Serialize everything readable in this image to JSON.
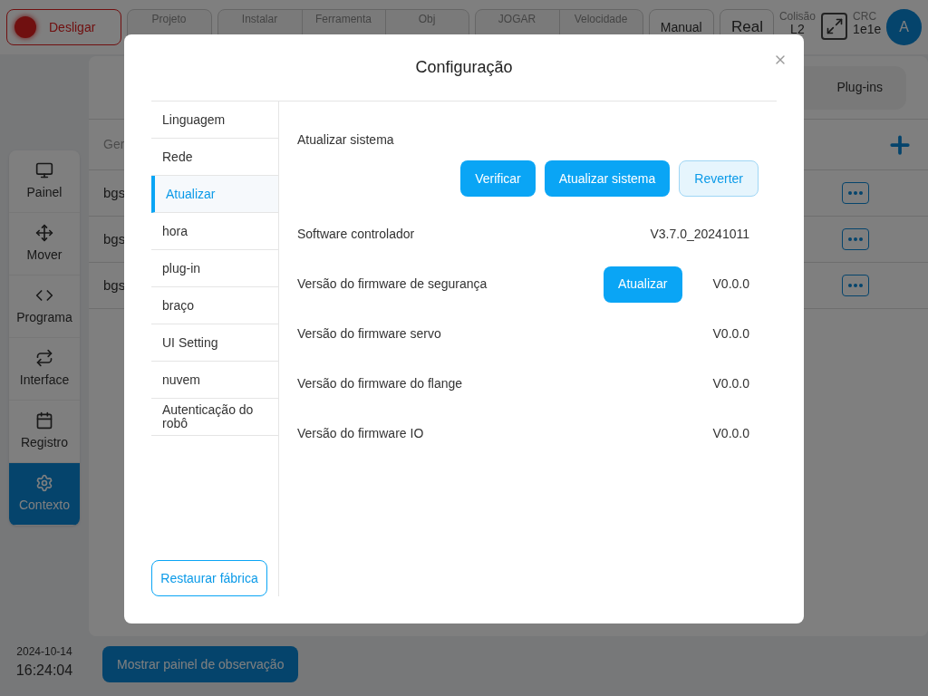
{
  "top_bar": {
    "power_button": "Desligar",
    "status_groups": [
      {
        "fields": [
          {
            "label": "Projeto"
          }
        ]
      },
      {
        "fields": [
          {
            "label": "Instalar"
          },
          {
            "label": "Ferramenta"
          },
          {
            "label": "Obj"
          }
        ]
      },
      {
        "fields": [
          {
            "label": "JOGAR"
          },
          {
            "label": "Velocidade"
          }
        ]
      }
    ],
    "mode_buttons": [
      "Manual",
      "Real"
    ],
    "collision": {
      "label": "Colisão",
      "value": "L2"
    },
    "crc": {
      "label": "CRC",
      "value": "1e1e"
    },
    "avatar": "A"
  },
  "nav": {
    "items": [
      {
        "label": "Painel",
        "selected": false
      },
      {
        "label": "Mover",
        "selected": false
      },
      {
        "label": "Programa",
        "selected": false
      },
      {
        "label": "Interface",
        "selected": false
      },
      {
        "label": "Registro",
        "selected": false
      },
      {
        "label": "Contexto",
        "selected": true
      }
    ]
  },
  "background_panel": {
    "tabs": [
      {
        "label": "Plug-ins"
      }
    ],
    "column_header": "Ger",
    "rows": [
      "bgs",
      "bgs",
      "bgs"
    ]
  },
  "clock": {
    "date": "2024-10-14",
    "time": "16:24:04"
  },
  "watch_button": "Mostrar painel de observação",
  "dialog": {
    "title": "Configuração",
    "menu": [
      {
        "label": "Linguagem",
        "selected": false
      },
      {
        "label": "Rede",
        "selected": false
      },
      {
        "label": "Atualizar",
        "selected": true
      },
      {
        "label": "hora",
        "selected": false
      },
      {
        "label": "plug-in",
        "selected": false
      },
      {
        "label": "braço",
        "selected": false
      },
      {
        "label": "UI Setting",
        "selected": false
      },
      {
        "label": "nuvem",
        "selected": false
      },
      {
        "label": "Autenticação do robô",
        "selected": false
      }
    ],
    "restore_button": "Restaurar fábrica",
    "section_title": "Atualizar sistema",
    "buttons": [
      {
        "label": "Verificar",
        "kind": "primary"
      },
      {
        "label": "Atualizar sistema",
        "kind": "primary"
      },
      {
        "label": "Reverter",
        "kind": "secondary"
      }
    ],
    "rows": [
      {
        "label": "Software controlador",
        "value": "V3.7.0_20241011"
      },
      {
        "label": "Versão do firmware de segurança",
        "value": "V0.0.0",
        "action": "Atualizar"
      },
      {
        "label": "Versão do firmware servo",
        "value": "V0.0.0"
      },
      {
        "label": "Versão do firmware do flange",
        "value": "V0.0.0"
      },
      {
        "label": "Versão do firmware IO",
        "value": "V0.0.0"
      }
    ]
  }
}
